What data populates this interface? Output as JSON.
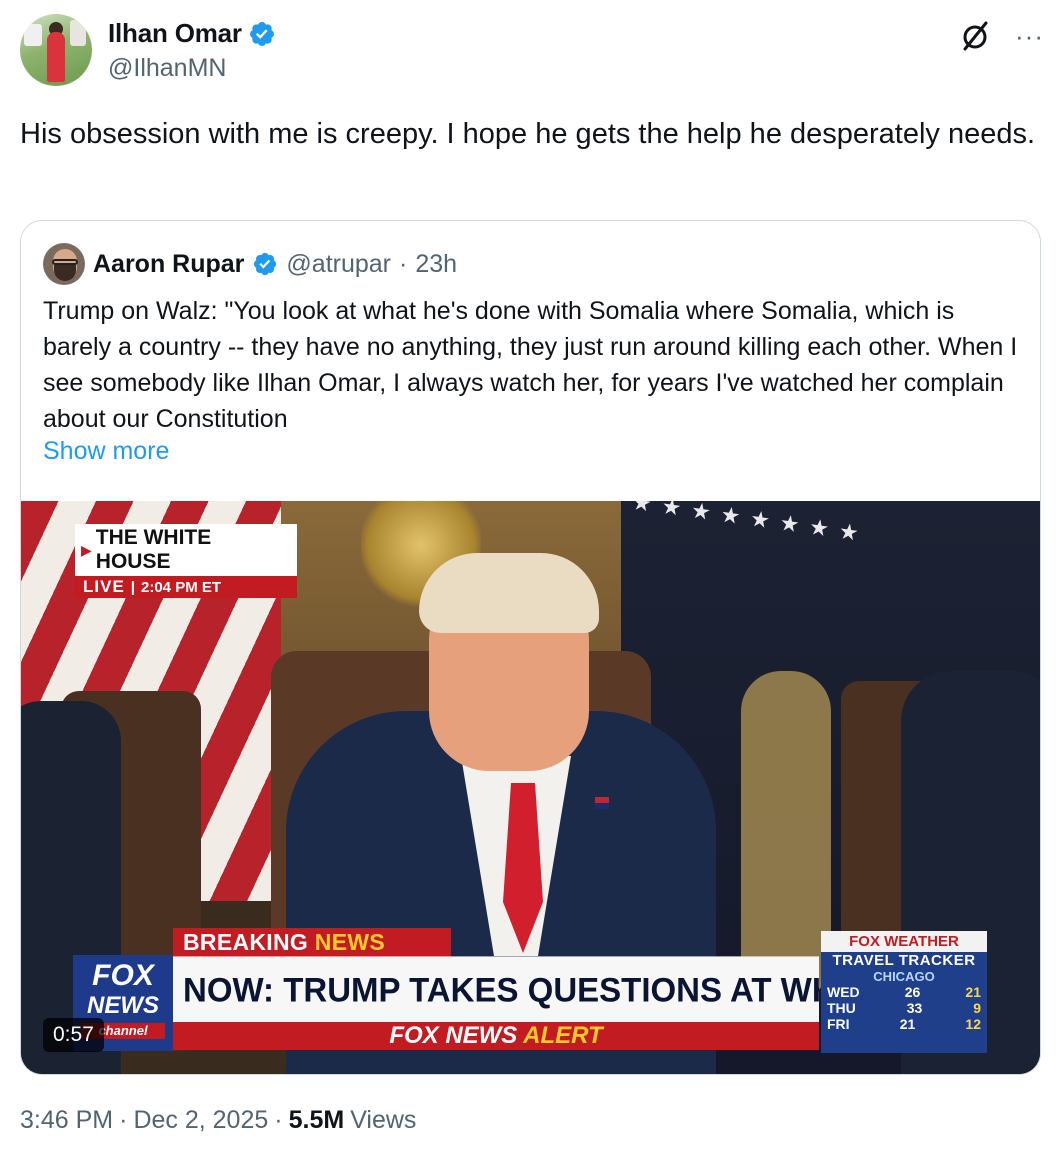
{
  "author": {
    "display_name": "Ilhan Omar",
    "handle": "@IlhanMN",
    "verified": true
  },
  "actions": {
    "grok_icon": "grok-icon",
    "more_icon": "more-icon",
    "more_label": "···"
  },
  "tweet_text": "His obsession with me is creepy. I hope he gets the help he desperately needs.",
  "quote": {
    "display_name": "Aaron Rupar",
    "handle": "@atrupar",
    "separator": "·",
    "age": "23h",
    "verified": true,
    "text": "Trump on Walz: \"You look at what he's done with Somalia where Somalia, which is barely a country -- they have no anything, they just run around killing each other. When I see somebody like Ilhan Omar, I always watch her, for years I've watched her complain about our Constitution",
    "show_more": "Show more",
    "video": {
      "duration": "0:57",
      "chyron_location": "THE WHITE HOUSE",
      "chyron_live": "LIVE",
      "chyron_time": "2:04 PM ET",
      "breaking_label": "BREAKING",
      "breaking_news": "NEWS",
      "headline": "NOW: TRUMP TAKES QUESTIONS AT WHITE HOUSE",
      "alert_brand": "FOX NEWS",
      "alert_word": "ALERT",
      "logo_line1": "FOX",
      "logo_line2": "NEWS",
      "logo_line3": "channel",
      "weather": {
        "brand": "FOX WEATHER",
        "title": "TRAVEL TRACKER",
        "city": "CHICAGO",
        "rows": [
          {
            "day": "WED",
            "hi": "26",
            "lo": "21"
          },
          {
            "day": "THU",
            "hi": "33",
            "lo": "9"
          },
          {
            "day": "FRI",
            "hi": "21",
            "lo": "12"
          }
        ]
      }
    }
  },
  "footer": {
    "time": "3:46 PM",
    "dot1": "·",
    "date": "Dec 2, 2025",
    "dot2": "·",
    "views_count": "5.5M",
    "views_label": "Views"
  },
  "colors": {
    "link": "#1d9bf0",
    "secondary_text": "#536471",
    "border": "#cfd9de",
    "verified_badge": "#1d9bf0"
  }
}
